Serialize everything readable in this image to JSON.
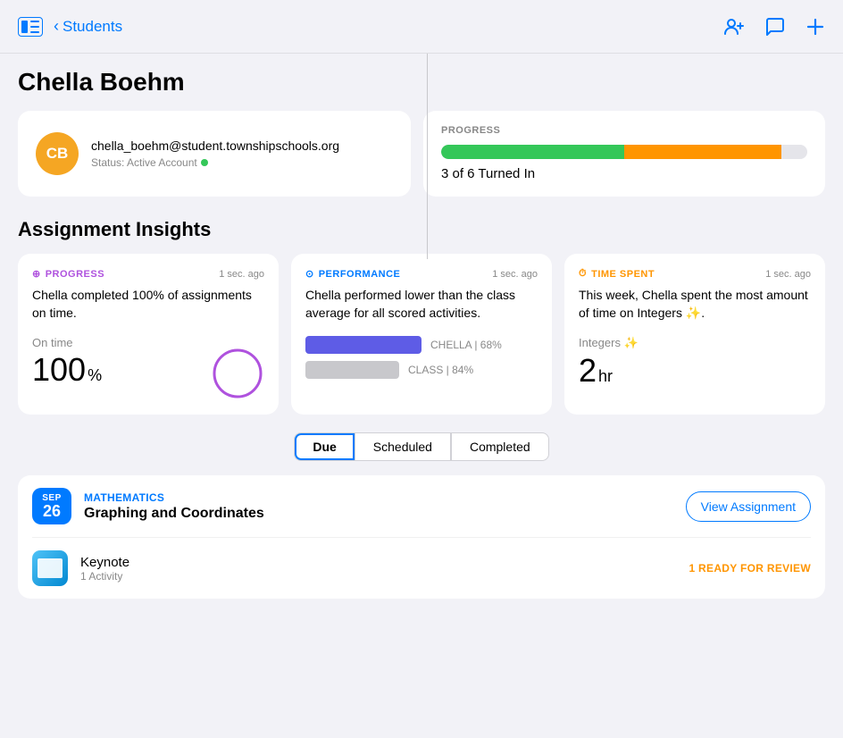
{
  "topbar": {
    "back_label": "Students",
    "icons": {
      "add_student": "person-plus-icon",
      "message": "message-icon",
      "plus": "plus-icon"
    }
  },
  "student": {
    "name": "Chella Boehm",
    "avatar_initials": "CB",
    "avatar_color": "#F5A623",
    "email": "chella_boehm@student.townshipschools.org",
    "status_text": "Status: Active Account"
  },
  "progress": {
    "label": "PROGRESS",
    "bar_green_pct": 50,
    "bar_orange_pct": 43,
    "summary": "3 of 6 Turned In"
  },
  "insights_section": {
    "title": "Assignment Insights",
    "cards": [
      {
        "tag": "PROGRESS",
        "tag_icon": "⊕",
        "time": "1 sec. ago",
        "description": "Chella completed 100% of assignments on time.",
        "metric_label": "On time",
        "metric_value": "100",
        "metric_unit": "%"
      },
      {
        "tag": "PERFORMANCE",
        "tag_icon": "⊙",
        "time": "1 sec. ago",
        "description": "Chella performed lower than the class average for all scored activities.",
        "chella_pct": 68,
        "class_pct": 84,
        "chella_label": "CHELLA | 68%",
        "class_label": "CLASS | 84%"
      },
      {
        "tag": "TIME SPENT",
        "tag_icon": "⏱",
        "time": "1 sec. ago",
        "description": "This week, Chella spent the most amount of time on Integers ✨.",
        "topic": "Integers ✨",
        "metric_value": "2",
        "metric_unit": "hr"
      }
    ]
  },
  "tabs": [
    {
      "label": "Due",
      "active": true
    },
    {
      "label": "Scheduled",
      "active": false
    },
    {
      "label": "Completed",
      "active": false
    }
  ],
  "assignments": [
    {
      "month": "SEP",
      "day": "26",
      "subject": "MATHEMATICS",
      "title": "Graphing and Coordinates",
      "view_label": "View Assignment",
      "items": [
        {
          "app_name": "Keynote",
          "activity_count": "1 Activity",
          "status": "1 READY FOR REVIEW"
        }
      ]
    }
  ]
}
